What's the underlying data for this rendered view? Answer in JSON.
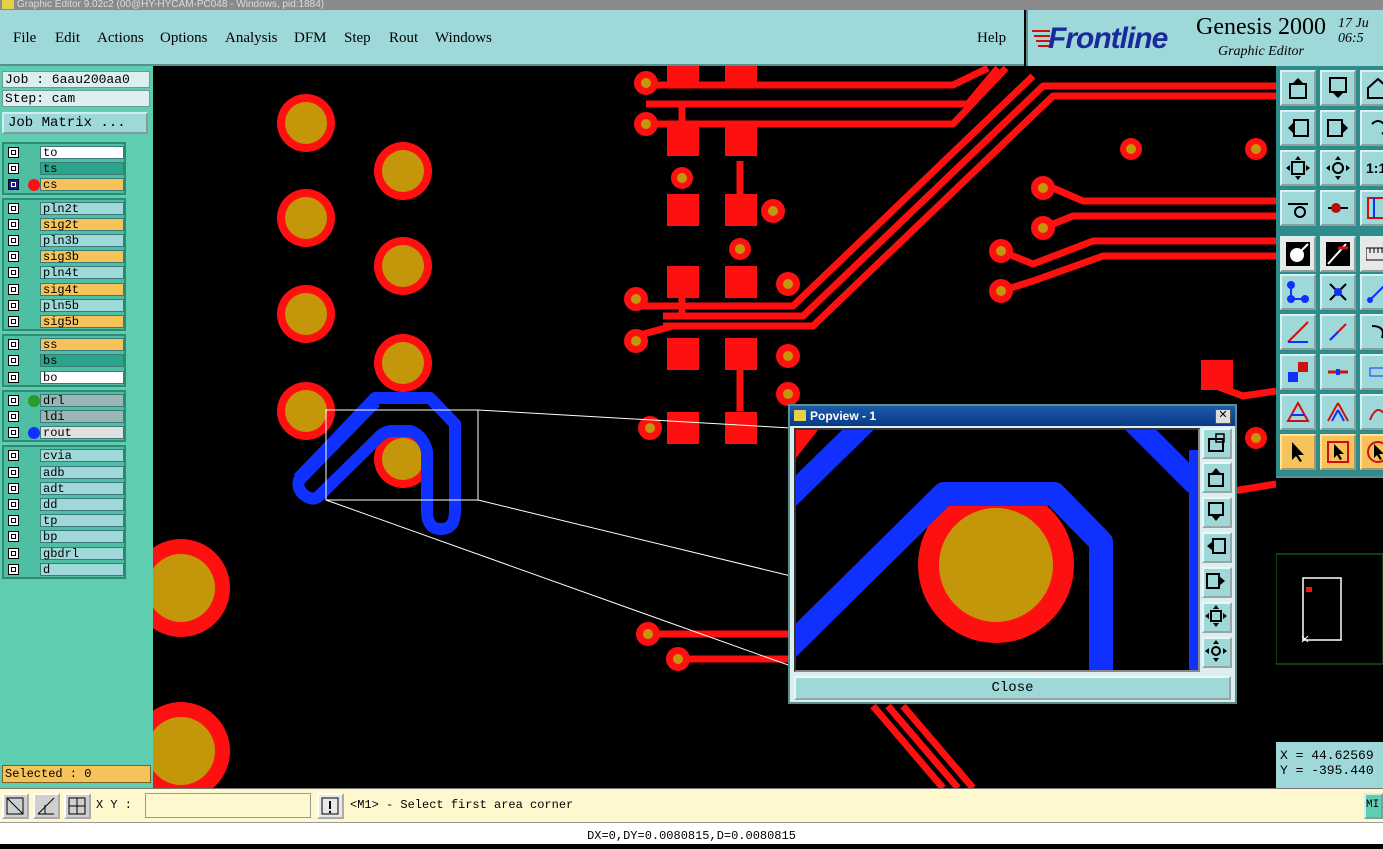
{
  "window": {
    "title": "Graphic Editor 9.02c2 (00@HY-HYCAM-PC048 - Windows, pid:1884)"
  },
  "menu": {
    "items": [
      {
        "label": "File",
        "name": "menu-file"
      },
      {
        "label": "Edit",
        "name": "menu-edit"
      },
      {
        "label": "Actions",
        "name": "menu-actions"
      },
      {
        "label": "Options",
        "name": "menu-options"
      },
      {
        "label": "Analysis",
        "name": "menu-analysis"
      },
      {
        "label": "DFM",
        "name": "menu-dfm"
      },
      {
        "label": "Step",
        "name": "menu-step"
      },
      {
        "label": "Rout",
        "name": "menu-rout"
      },
      {
        "label": "Windows",
        "name": "menu-windows"
      }
    ],
    "help": "Help"
  },
  "brand": {
    "logo": "Frontline",
    "product": "Genesis 2000",
    "subtitle": "Graphic Editor",
    "date_line1": "17 Ju",
    "date_line2": "06:5"
  },
  "job": {
    "job_label": "Job : 6aau200aa0",
    "step_label": "Step: cam",
    "matrix_button": "Job Matrix ..."
  },
  "layers": [
    {
      "name": "to",
      "color": "#ffffff",
      "active": false,
      "dot": ""
    },
    {
      "name": "ts",
      "color": "#2aa58a",
      "active": false,
      "dot": ""
    },
    {
      "name": "cs",
      "color": "#f5c35a",
      "active": true,
      "dot": "#ff1010"
    },
    {
      "name": "pln2t",
      "color": "#9fd8d8",
      "active": false,
      "dot": ""
    },
    {
      "name": "sig2t",
      "color": "#f5c35a",
      "active": false,
      "dot": ""
    },
    {
      "name": "pln3b",
      "color": "#9fd8d8",
      "active": false,
      "dot": ""
    },
    {
      "name": "sig3b",
      "color": "#f5c35a",
      "active": false,
      "dot": ""
    },
    {
      "name": "pln4t",
      "color": "#9fd8d8",
      "active": false,
      "dot": ""
    },
    {
      "name": "sig4t",
      "color": "#f5c35a",
      "active": false,
      "dot": ""
    },
    {
      "name": "pln5b",
      "color": "#9fd8d8",
      "active": false,
      "dot": ""
    },
    {
      "name": "sig5b",
      "color": "#f5c35a",
      "active": false,
      "dot": ""
    },
    {
      "name": "ss",
      "color": "#f5c35a",
      "active": false,
      "dot": ""
    },
    {
      "name": "bs",
      "color": "#2aa58a",
      "active": false,
      "dot": ""
    },
    {
      "name": "bo",
      "color": "#ffffff",
      "active": false,
      "dot": ""
    },
    {
      "name": "drl",
      "color": "#9ab5b5",
      "active": false,
      "dot": "#2a9a2a"
    },
    {
      "name": "ldi",
      "color": "#9ab5b5",
      "active": false,
      "dot": ""
    },
    {
      "name": "rout",
      "color": "#e0e0e0",
      "active": false,
      "dot": "#1030ff"
    },
    {
      "name": "cvia",
      "color": "#9fd8d8",
      "active": false,
      "dot": ""
    },
    {
      "name": "adb",
      "color": "#9fd8d8",
      "active": false,
      "dot": ""
    },
    {
      "name": "adt",
      "color": "#9fd8d8",
      "active": false,
      "dot": ""
    },
    {
      "name": "dd",
      "color": "#9fd8d8",
      "active": false,
      "dot": ""
    },
    {
      "name": "tp",
      "color": "#9fd8d8",
      "active": false,
      "dot": ""
    },
    {
      "name": "bp",
      "color": "#9fd8d8",
      "active": false,
      "dot": ""
    },
    {
      "name": "gbdrl",
      "color": "#9fd8d8",
      "active": false,
      "dot": ""
    },
    {
      "name": "d",
      "color": "#9fd8d8",
      "active": false,
      "dot": ""
    }
  ],
  "selected": "Selected : 0",
  "coords": {
    "x": "X = 44.62569",
    "y": "Y = -395.440"
  },
  "bottom": {
    "xy_label": "X Y :",
    "xy_value": "",
    "prompt": "<M1> - Select first area corner",
    "right_button": "MI"
  },
  "status": "DX=0,DY=0.0080815,D=0.0080815",
  "popview": {
    "title": "Popview - 1",
    "close_label": "Close"
  },
  "colors": {
    "copper": "#ff1010",
    "drill": "#c4960a",
    "rout": "#1030ff",
    "panel": "#5fcdb0",
    "menu": "#9fd8d8"
  }
}
